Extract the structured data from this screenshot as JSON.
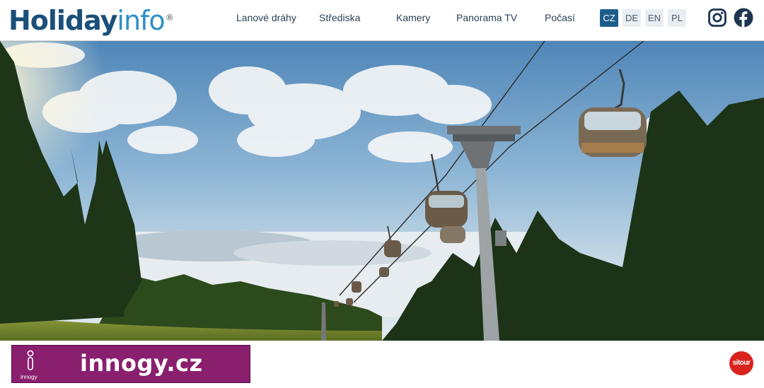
{
  "header": {
    "logo_part1": "Holiday",
    "logo_part2": "info",
    "logo_reg": "®",
    "nav": [
      "Lanové dráhy",
      "Střediska",
      "Kamery",
      "Panorama TV",
      "Počasí"
    ],
    "languages": [
      {
        "code": "CZ",
        "active": true
      },
      {
        "code": "DE",
        "active": false
      },
      {
        "code": "EN",
        "active": false
      },
      {
        "code": "PL",
        "active": false
      }
    ],
    "social": [
      "instagram-icon",
      "facebook-icon"
    ]
  },
  "footer": {
    "ad_text": "innogy.cz",
    "ad_brand": "innogy",
    "partner_logo": "sitour"
  },
  "colors": {
    "brand_dark": "#1b4f7a",
    "brand_light": "#2c8fc9",
    "lang_active": "#1d5d8a",
    "ad_bg": "#8a1f6e",
    "sitour_red": "#d8231f"
  }
}
